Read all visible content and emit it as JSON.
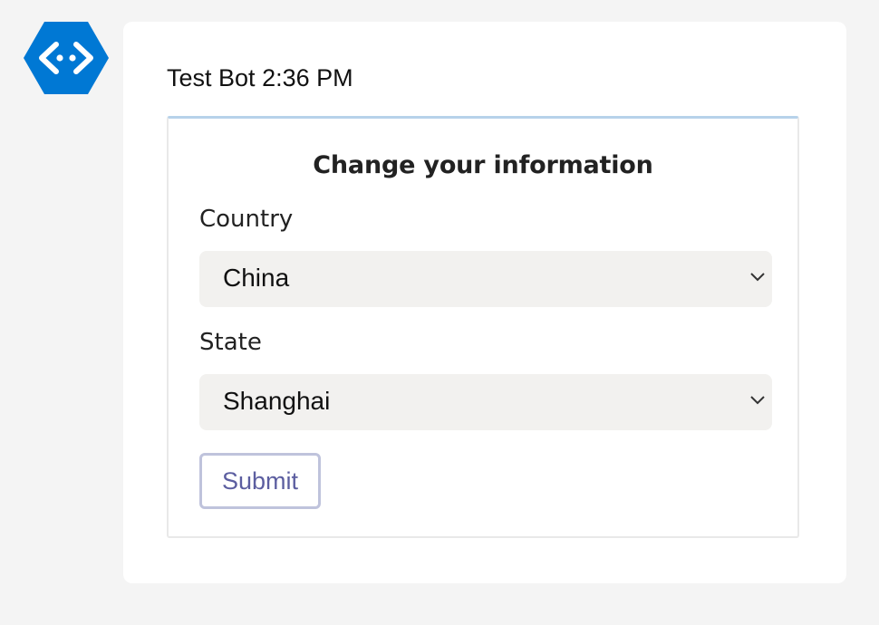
{
  "bot": {
    "avatar_icon": "bot-framework-icon",
    "brand_color": "#0078d4"
  },
  "message": {
    "sender": "Test Bot",
    "time": "2:36 PM"
  },
  "card": {
    "title": "Change your information",
    "country": {
      "label": "Country",
      "selected": "China",
      "icon": "chevron-down-icon"
    },
    "state": {
      "label": "State",
      "selected": "Shanghai",
      "icon": "chevron-down-icon"
    },
    "submit_label": "Submit",
    "accent_color": "#b7d2ea",
    "button_text_color": "#5c5ea0"
  }
}
